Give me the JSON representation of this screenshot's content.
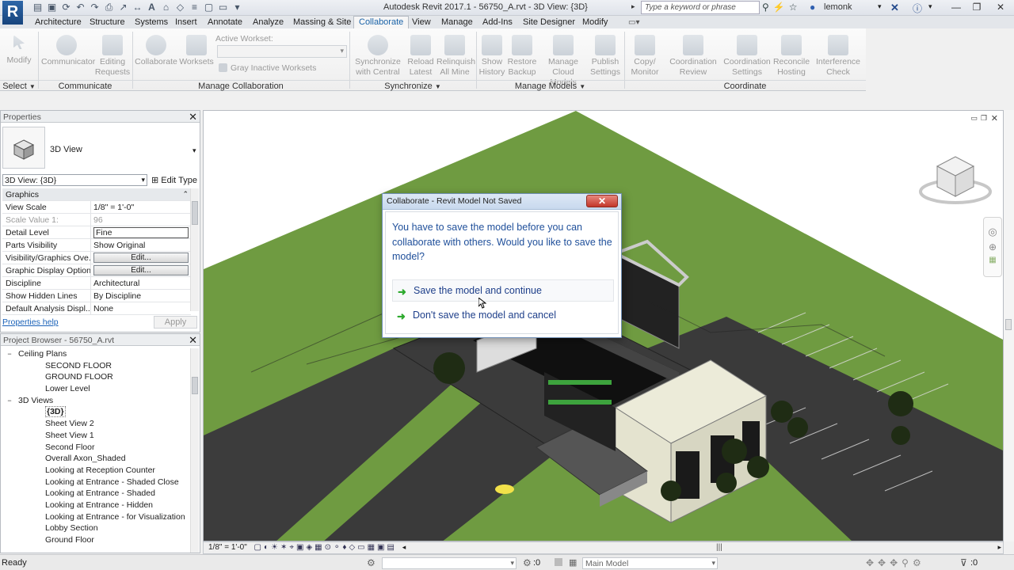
{
  "app": {
    "title": "Autodesk Revit 2017.1 -    56750_A.rvt - 3D View: {3D}",
    "logo": "R",
    "search_placeholder": "Type a keyword or phrase",
    "user": "lemonk"
  },
  "tabs": [
    "Architecture",
    "Structure",
    "Systems",
    "Insert",
    "Annotate",
    "Analyze",
    "Massing & Site",
    "Collaborate",
    "View",
    "Manage",
    "Add-Ins",
    "Site Designer",
    "Modify"
  ],
  "active_tab": "Collaborate",
  "ribbon": {
    "modify": "Modify",
    "communicator": "Communicator",
    "editing_requests": "Editing Requests",
    "collaborate": "Collaborate",
    "worksets": "Worksets",
    "active_workset": "Active Workset:",
    "gray_inactive": "Gray Inactive Worksets",
    "sync_central": "Synchronize with Central",
    "reload_latest": "Reload Latest",
    "relinquish_all": "Relinquish All Mine",
    "show_history": "Show History",
    "restore_backup": "Restore Backup",
    "manage_cloud": "Manage Cloud Models",
    "publish_settings": "Publish Settings",
    "copy_monitor": "Copy/ Monitor",
    "coord_review": "Coordination Review",
    "coord_settings": "Coordination Settings",
    "reconcile_hosting": "Reconcile Hosting",
    "interference_check": "Interference Check",
    "panels": {
      "select": "Select",
      "communicate": "Communicate",
      "manage_collab": "Manage Collaboration",
      "synchronize": "Synchronize",
      "manage_models": "Manage Models",
      "coordinate": "Coordinate"
    }
  },
  "properties": {
    "header": "Properties",
    "type_name": "3D View",
    "selector": "3D View: {3D}",
    "edit_type": "Edit Type",
    "section": "Graphics",
    "rows": [
      {
        "k": "View Scale",
        "v": "1/8\" = 1'-0\""
      },
      {
        "k": "Scale Value    1:",
        "v": "96"
      },
      {
        "k": "Detail Level",
        "v": "Fine"
      },
      {
        "k": "Parts Visibility",
        "v": "Show Original"
      },
      {
        "k": "Visibility/Graphics Ove...",
        "v": "Edit..."
      },
      {
        "k": "Graphic Display Options",
        "v": "Edit..."
      },
      {
        "k": "Discipline",
        "v": "Architectural"
      },
      {
        "k": "Show Hidden Lines",
        "v": "By Discipline"
      },
      {
        "k": "Default Analysis Displ...",
        "v": "None"
      }
    ],
    "help": "Properties help",
    "apply": "Apply"
  },
  "browser": {
    "header": "Project Browser - 56750_A.rvt",
    "items": [
      {
        "label": "Ceiling Plans",
        "level": 1,
        "exp": "−"
      },
      {
        "label": "SECOND FLOOR",
        "level": 2
      },
      {
        "label": "GROUND FLOOR",
        "level": 2
      },
      {
        "label": "Lower Level",
        "level": 2
      },
      {
        "label": "3D Views",
        "level": 1,
        "exp": "−"
      },
      {
        "label": "{3D}",
        "level": 2,
        "bold": true
      },
      {
        "label": "Sheet View 2",
        "level": 2
      },
      {
        "label": "Sheet View 1",
        "level": 2
      },
      {
        "label": "Second Floor",
        "level": 2
      },
      {
        "label": "Overall Axon_Shaded",
        "level": 2
      },
      {
        "label": "Looking at Reception Counter",
        "level": 2
      },
      {
        "label": "Looking at Entrance - Shaded Close",
        "level": 2
      },
      {
        "label": "Looking at Entrance - Shaded",
        "level": 2
      },
      {
        "label": "Looking at Entrance - Hidden",
        "level": 2
      },
      {
        "label": "Looking at Entrance - for Visualization",
        "level": 2
      },
      {
        "label": "Lobby Section",
        "level": 2
      },
      {
        "label": "Ground Floor",
        "level": 2
      }
    ]
  },
  "dialog": {
    "title": "Collaborate - Revit Model Not Saved",
    "message": "You have to save the model before you can collaborate with others.  Would you like to save the model?",
    "option1": "Save the model and continue",
    "option2": "Don't save the model and cancel",
    "close": "✕"
  },
  "view_control": {
    "scale": "1/8\" = 1'-0\""
  },
  "status": {
    "text": "Ready",
    "count": ":0",
    "model": "Main Model",
    "sel_count": ":0"
  },
  "colors": {
    "accent": "#1a63a8",
    "dialog_text": "#1f4f9a",
    "grass": "#6f9b41",
    "road": "#3c3c3c"
  }
}
